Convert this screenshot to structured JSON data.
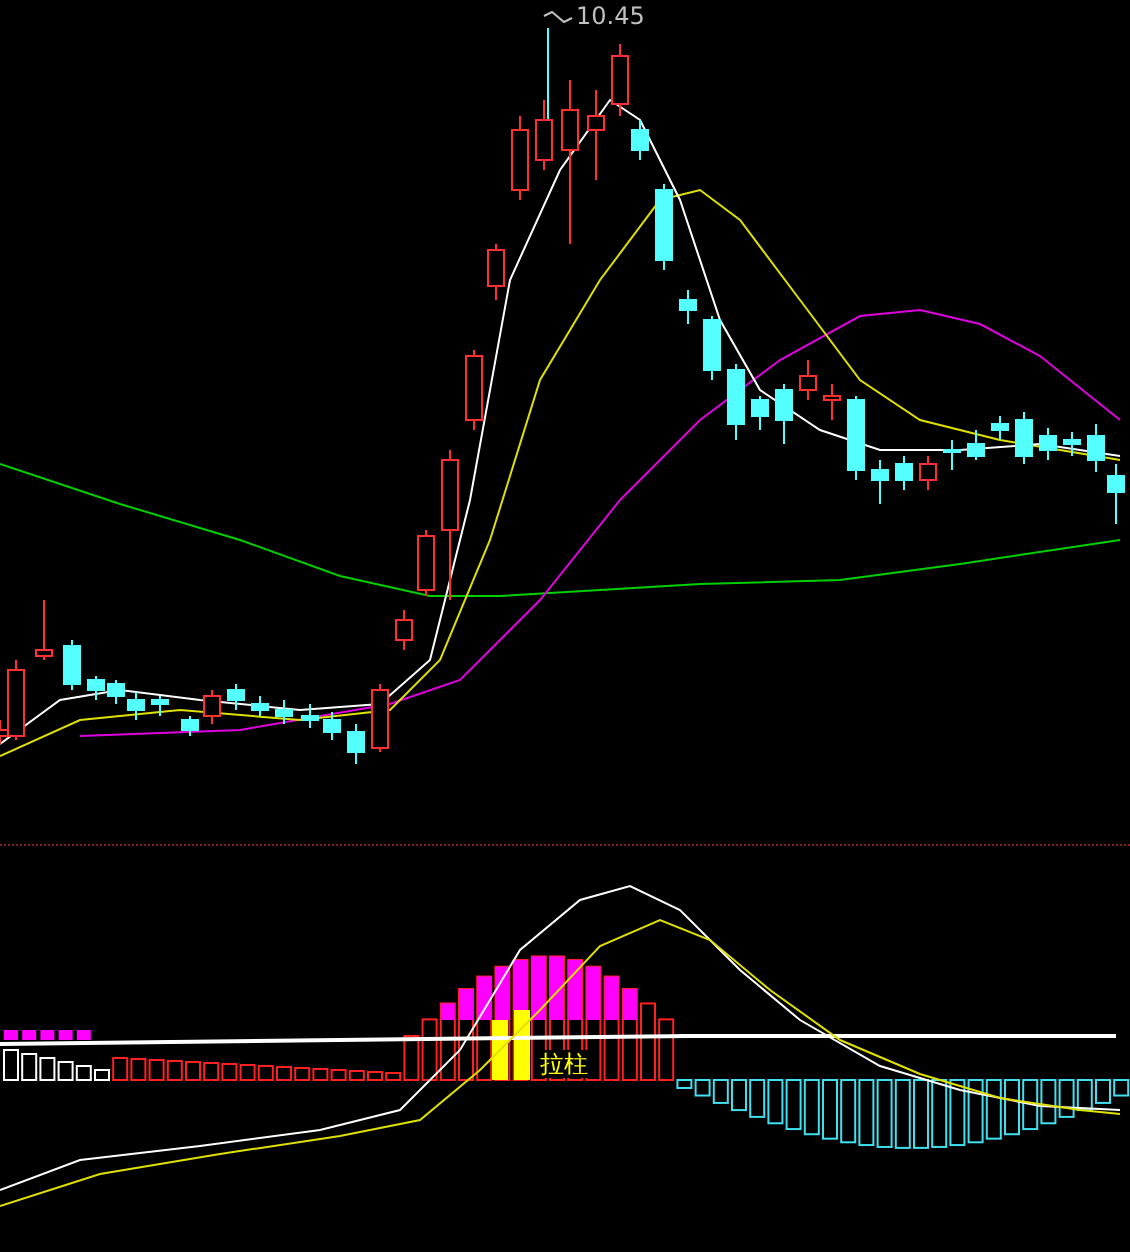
{
  "price_chart": {
    "peak_label": "10.45"
  },
  "indicator_chart": {
    "label": "拉柱"
  }
}
